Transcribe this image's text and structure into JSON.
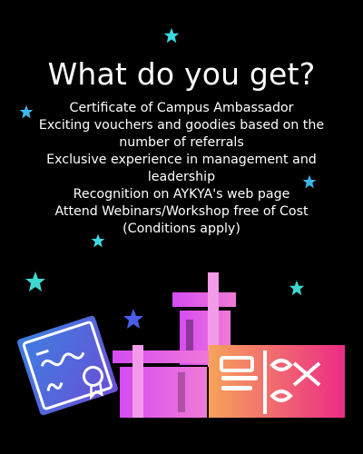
{
  "title": "What do you get?",
  "benefits": [
    "Certificate of Campus Ambassador",
    "Exciting vouchers and goodies based on the number of referrals",
    "Exclusive experience in management and leadership",
    "Recognition on AYKYA's web page",
    "Attend Webinars/Workshop free of Cost (Conditions apply)"
  ],
  "colors": {
    "background": "#000000",
    "text": "#ffffff",
    "star_cyan": "#3fd8e0",
    "star_blue": "#4a5de8",
    "gift_pink": "#e85cf0",
    "voucher_left": "#f4a15a",
    "voucher_right": "#ef2f7d",
    "certificate_blue": "#4b6fd8"
  },
  "illustration": {
    "items": [
      "certificate-icon",
      "gift-box-icon",
      "voucher-icon",
      "star-icon"
    ]
  }
}
